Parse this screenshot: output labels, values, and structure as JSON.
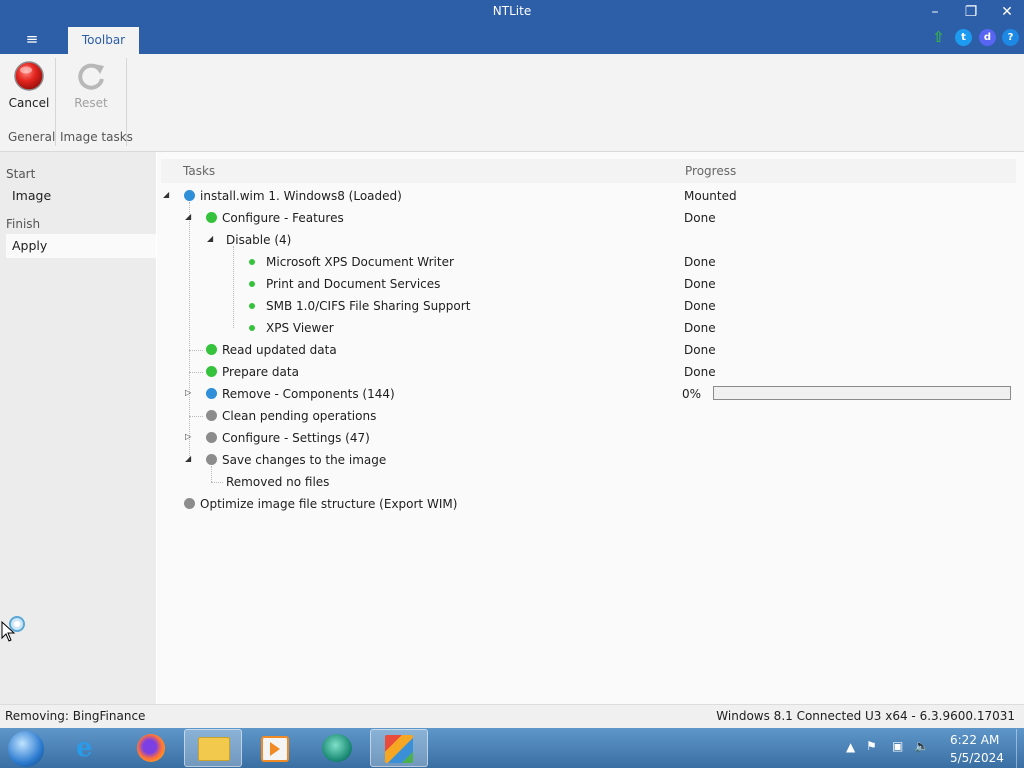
{
  "window": {
    "title": "NTLite",
    "controls": [
      "minimize",
      "restore",
      "close"
    ]
  },
  "header": {
    "menu_icon": "hamburger-icon",
    "tab_label": "Toolbar",
    "social_icons": [
      "update-arrow-icon",
      "twitter-icon",
      "discord-icon",
      "help-icon"
    ]
  },
  "ribbon": {
    "cancel_label": "Cancel",
    "reset_label": "Reset",
    "group_general": "General",
    "group_image_tasks": "Image tasks"
  },
  "nav": {
    "start_heading": "Start",
    "image_label": "Image",
    "finish_heading": "Finish",
    "apply_label": "Apply"
  },
  "tasks": {
    "col_tasks": "Tasks",
    "col_progress": "Progress",
    "rows": [
      {
        "label": "install.wim 1. Windows8  (Loaded)",
        "progress": "Mounted"
      },
      {
        "label": "Configure - Features",
        "progress": "Done"
      },
      {
        "label": "Disable (4)",
        "progress": ""
      },
      {
        "label": "Microsoft XPS Document Writer",
        "progress": "Done"
      },
      {
        "label": "Print and Document Services",
        "progress": "Done"
      },
      {
        "label": "SMB 1.0/CIFS File Sharing Support",
        "progress": "Done"
      },
      {
        "label": "XPS Viewer",
        "progress": "Done"
      },
      {
        "label": "Read updated data",
        "progress": "Done"
      },
      {
        "label": "Prepare data",
        "progress": "Done"
      },
      {
        "label": "Remove - Components (144)",
        "progress": "0%",
        "progress_fraction": 0.0
      },
      {
        "label": "Clean pending operations",
        "progress": ""
      },
      {
        "label": "Configure - Settings (47)",
        "progress": ""
      },
      {
        "label": "Save changes to the image",
        "progress": ""
      },
      {
        "label": "Removed no files",
        "progress": ""
      },
      {
        "label": "Optimize image file structure (Export WIM)",
        "progress": ""
      }
    ]
  },
  "statusbar": {
    "left": "Removing: BingFinance",
    "right": "Windows 8.1 Connected U3 x64 - 6.3.9600.17031"
  },
  "taskbar": {
    "apps": [
      "start-orb-icon",
      "internet-explorer-icon",
      "firefox-icon",
      "file-explorer-icon",
      "media-player-icon",
      "app-icon",
      "ntlite-icon"
    ],
    "time": "6:22 AM",
    "date": "5/5/2024"
  },
  "colors": {
    "title_bar": "#2d5ea8",
    "done_green": "#35c23c",
    "active_blue": "#2f8fd8",
    "pending_gray": "#8c8c8c"
  }
}
